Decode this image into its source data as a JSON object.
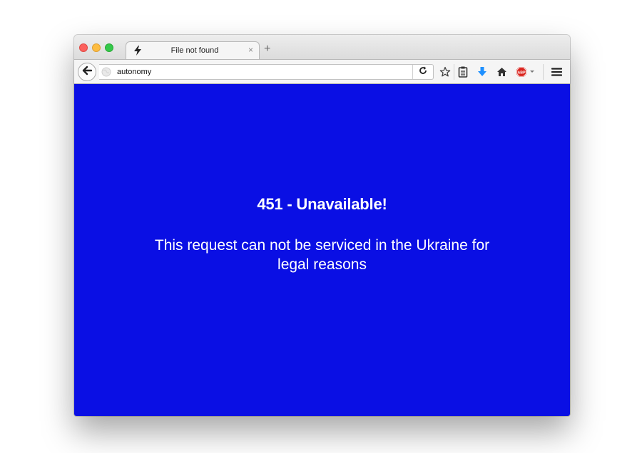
{
  "tab": {
    "title": "File not found",
    "close_glyph": "×",
    "new_tab_glyph": "+",
    "icon": "lightning-icon"
  },
  "navbar": {
    "url": "autonomy",
    "back_icon": "back-arrow-icon",
    "site_icon": "globe-icon",
    "reload_icon": "reload-icon",
    "toolbar_icons": [
      "bookmark-star-icon",
      "reading-list-icon",
      "downloads-icon",
      "home-icon",
      "adblock-plus-icon",
      "menu-icon"
    ],
    "abp_label": "ABP"
  },
  "page": {
    "title": "451 - Unavailable!",
    "message": "This request can not be serviced in the Ukraine for legal reasons",
    "background": "#0a0fe4",
    "text_color": "#ffffff"
  },
  "colors": {
    "download_accent": "#1e90ff",
    "abp_red": "#d9231d"
  }
}
